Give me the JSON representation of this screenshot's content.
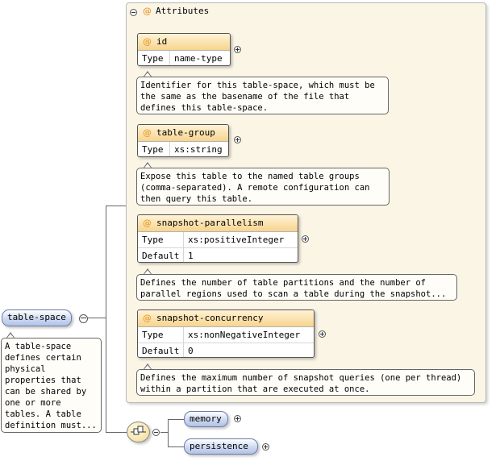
{
  "attributes_group": {
    "symbol": "@",
    "title": "Attributes"
  },
  "attributes": [
    {
      "name": "id",
      "rows": [
        {
          "key": "Type",
          "value": "name-type"
        }
      ],
      "doc": "Identifier for this table-space, which must be the same as the basename of the file that defines this table-space."
    },
    {
      "name": "table-group",
      "rows": [
        {
          "key": "Type",
          "value": "xs:string"
        }
      ],
      "doc": "Expose this table to the named table groups (comma-separated). A remote configuration can then query this table."
    },
    {
      "name": "snapshot-parallelism",
      "rows": [
        {
          "key": "Type",
          "value": "xs:positiveInteger"
        },
        {
          "key": "Default",
          "value": "1"
        }
      ],
      "doc": "Defines the number of table partitions and the number of parallel regions used to scan a table during the snapshot..."
    },
    {
      "name": "snapshot-concurrency",
      "rows": [
        {
          "key": "Type",
          "value": "xs:nonNegativeInteger"
        },
        {
          "key": "Default",
          "value": "0"
        }
      ],
      "doc": "Defines the maximum number of snapshot queries (one per thread) within a partition that are executed at once."
    }
  ],
  "root_element": {
    "name": "table-space",
    "doc": "A table-space defines certain physical properties that can be shared by one or more tables. A table definition must..."
  },
  "sequence_children": [
    {
      "name": "memory"
    },
    {
      "name": "persistence"
    }
  ]
}
